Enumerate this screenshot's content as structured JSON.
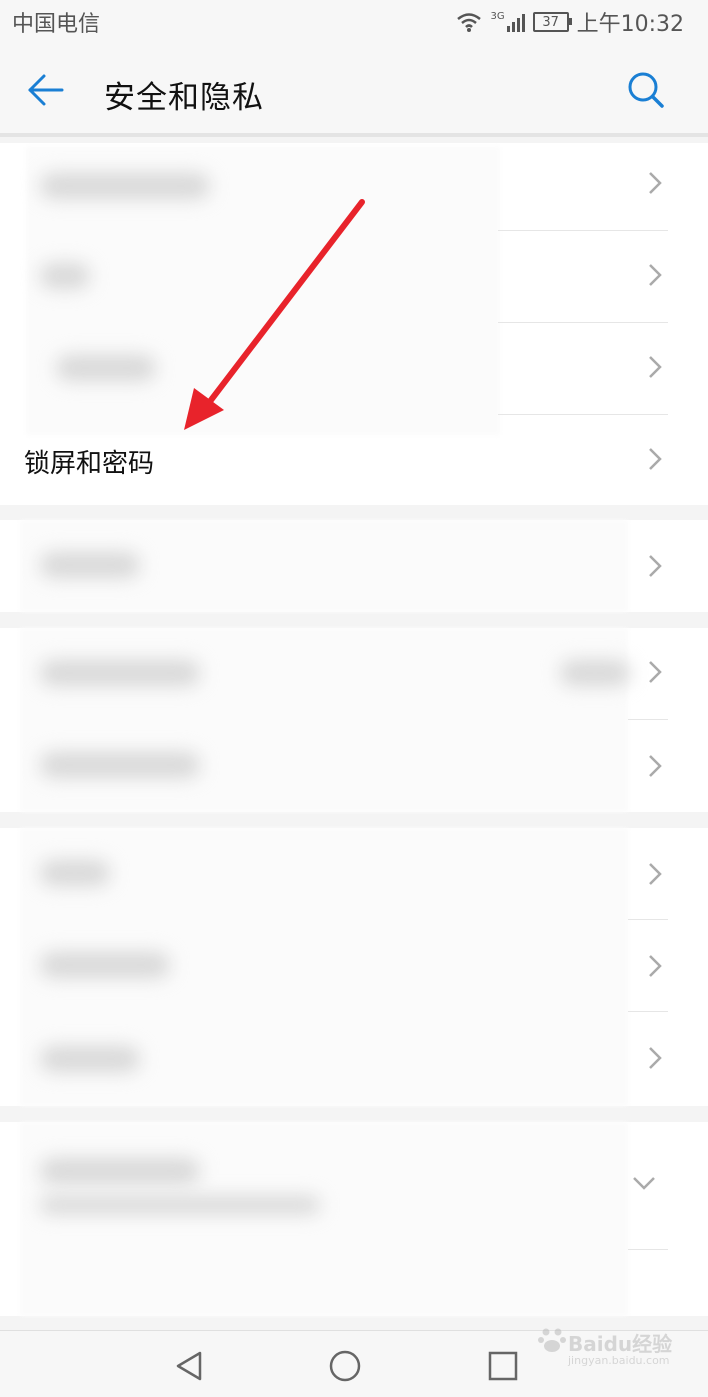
{
  "status": {
    "carrier": "中国电信",
    "network": "3G",
    "battery": "37",
    "time": "上午10:32"
  },
  "header": {
    "title": "安全和隐私",
    "back_icon": "back-arrow-icon",
    "search_icon": "search-icon"
  },
  "list": {
    "lock_screen_label": "锁屏和密码"
  },
  "navbar": {
    "back": "nav-back-icon",
    "home": "nav-home-icon",
    "recent": "nav-recent-icon"
  },
  "watermark": {
    "text": "Baidu经验",
    "url": "jingyan.baidu.com"
  },
  "colors": {
    "accent": "#1a7fd4",
    "arrow": "#e8232b"
  }
}
